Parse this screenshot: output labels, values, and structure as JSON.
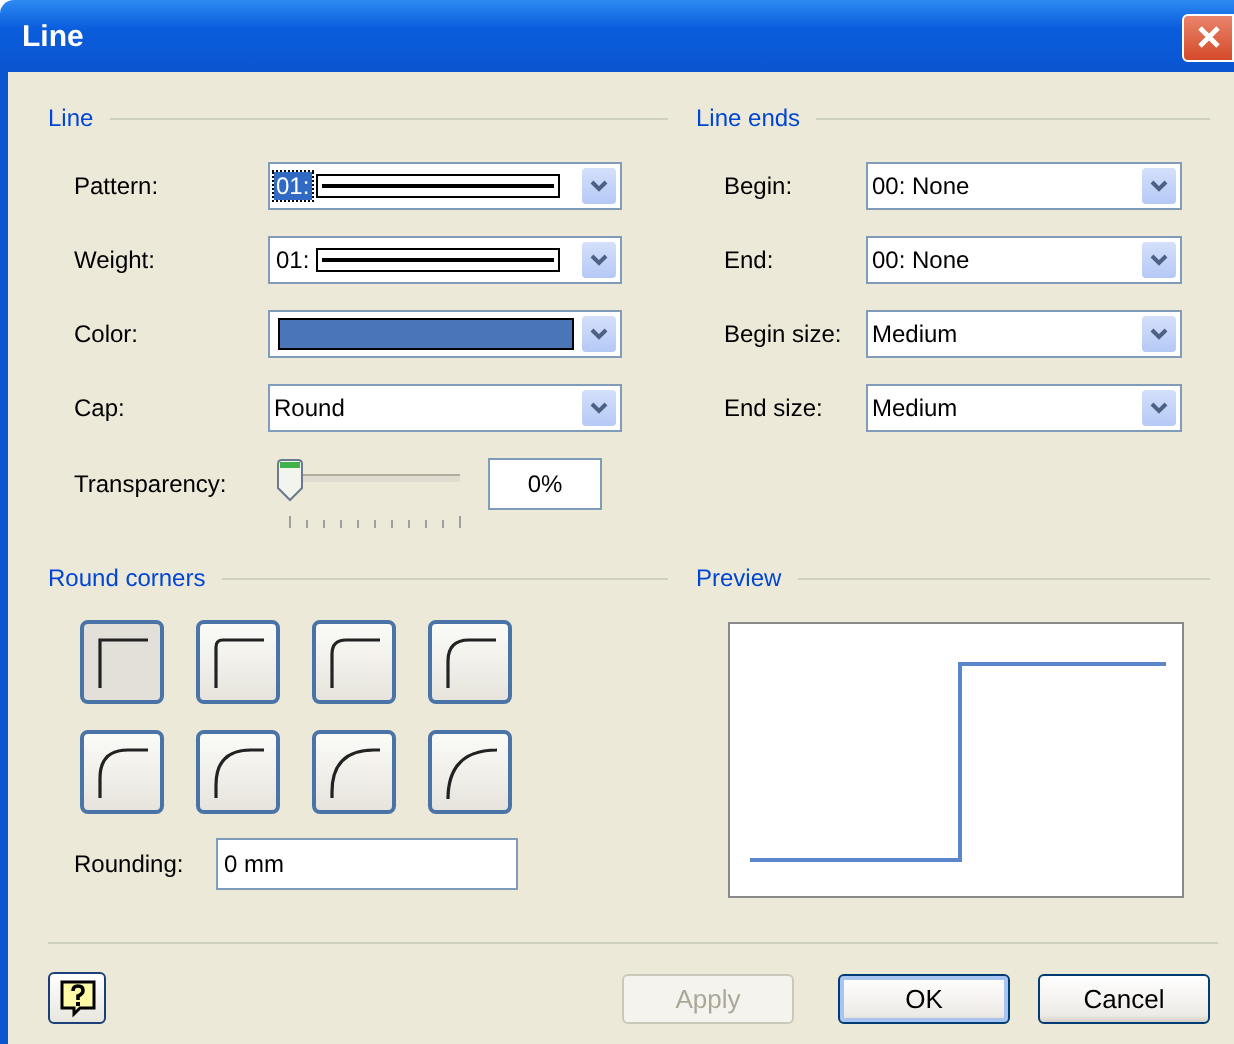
{
  "window": {
    "title": "Line"
  },
  "line": {
    "title": "Line",
    "fields": [
      {
        "kind": "pattern",
        "label": "Pattern:",
        "value": "01:",
        "focused": true
      },
      {
        "kind": "pattern",
        "label": "Weight:",
        "value": "01:",
        "focused": false
      },
      {
        "kind": "color",
        "label": "Color:",
        "color": "#4a76b8"
      },
      {
        "kind": "text",
        "label": "Cap:",
        "value": "Round"
      }
    ],
    "transparency": {
      "label": "Transparency:",
      "level": 0,
      "value": "0%"
    }
  },
  "line_ends": {
    "title": "Line ends",
    "fields": [
      {
        "label": "Begin:",
        "value": "00: None"
      },
      {
        "label": "End:",
        "value": "00: None"
      },
      {
        "label": "Begin size:",
        "value": "Medium"
      },
      {
        "label": "End size:",
        "value": "Medium"
      }
    ]
  },
  "round_corners": {
    "title": "Round corners",
    "options": [
      {
        "selected": true
      },
      {
        "selected": false
      },
      {
        "selected": false
      },
      {
        "selected": false
      },
      {
        "selected": false
      },
      {
        "selected": false
      },
      {
        "selected": false
      },
      {
        "selected": false
      }
    ],
    "rounding": {
      "label": "Rounding:",
      "value": "0 mm"
    }
  },
  "preview": {
    "title": "Preview"
  },
  "buttons": [
    {
      "label": "Apply",
      "disabled": true,
      "default": false
    },
    {
      "label": "OK",
      "disabled": false,
      "default": true
    },
    {
      "label": "Cancel",
      "disabled": false,
      "default": false
    }
  ]
}
